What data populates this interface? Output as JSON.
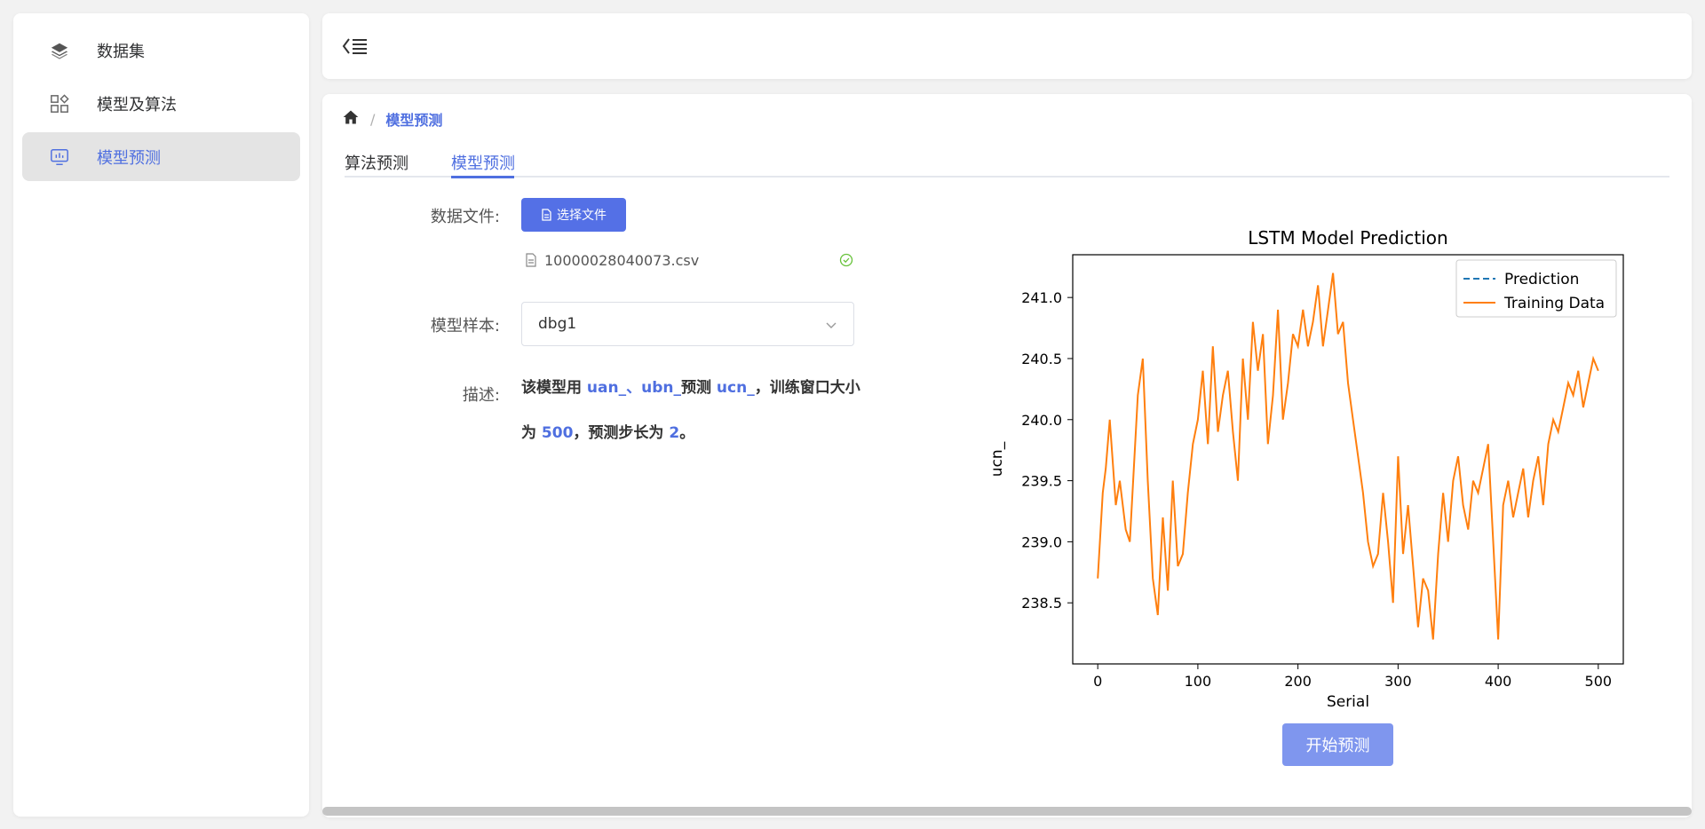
{
  "sidebar": {
    "items": [
      {
        "label": "数据集",
        "icon": "layers-icon",
        "active": false
      },
      {
        "label": "模型及算法",
        "icon": "grid-icon",
        "active": false
      },
      {
        "label": "模型预测",
        "icon": "monitor-icon",
        "active": true
      }
    ]
  },
  "header": {
    "collapse_icon": "menu-fold-icon"
  },
  "breadcrumb": {
    "home_icon": "home-icon",
    "separator": "/",
    "current": "模型预测"
  },
  "tabs": [
    {
      "label": "算法预测",
      "active": false
    },
    {
      "label": "模型预测",
      "active": true
    }
  ],
  "form": {
    "file_label": "数据文件:",
    "file_button": "选择文件",
    "file_name": "10000028040073.csv",
    "sample_label": "模型样本:",
    "sample_value": "dbg1",
    "desc_label": "描述:",
    "desc_parts": {
      "p1": "该模型用 ",
      "h1": "uan_、ubn_",
      "p2": "预测 ",
      "h2": "ucn_",
      "p3": "，训练窗口大小为 ",
      "h3": "500",
      "p4": "，预测步长为 ",
      "h4": "2",
      "p5": "。"
    }
  },
  "start_button": "开始预测",
  "colors": {
    "accent": "#5470e6",
    "prediction": "#1f77b4",
    "training": "#ff7f0e"
  },
  "chart_data": {
    "type": "line",
    "title": "LSTM Model Prediction",
    "xlabel": "Serial",
    "ylabel": "ucn_",
    "xlim": [
      -25,
      525
    ],
    "ylim": [
      238.0,
      241.35
    ],
    "xticks": [
      0,
      100,
      200,
      300,
      400,
      500
    ],
    "yticks": [
      238.5,
      239.0,
      239.5,
      240.0,
      240.5,
      241.0
    ],
    "legend_position": "top-right",
    "series": [
      {
        "name": "Prediction",
        "style": "dashed",
        "color": "#1f77b4",
        "x": [],
        "values": []
      },
      {
        "name": "Training Data",
        "style": "solid",
        "color": "#ff7f0e",
        "x": [
          0,
          5,
          8,
          12,
          18,
          22,
          28,
          32,
          36,
          40,
          45,
          50,
          55,
          60,
          65,
          70,
          75,
          80,
          85,
          90,
          95,
          100,
          105,
          110,
          115,
          120,
          125,
          130,
          135,
          140,
          145,
          150,
          155,
          160,
          165,
          170,
          175,
          180,
          185,
          190,
          195,
          200,
          205,
          210,
          215,
          220,
          225,
          230,
          235,
          240,
          245,
          250,
          255,
          260,
          265,
          270,
          275,
          280,
          285,
          290,
          295,
          300,
          305,
          310,
          315,
          320,
          325,
          330,
          335,
          340,
          345,
          350,
          355,
          360,
          365,
          370,
          375,
          380,
          385,
          390,
          395,
          400,
          405,
          410,
          415,
          420,
          425,
          430,
          435,
          440,
          445,
          450,
          455,
          460,
          465,
          470,
          475,
          480,
          485,
          490,
          495,
          500
        ],
        "values": [
          238.7,
          239.4,
          239.6,
          240.0,
          239.3,
          239.5,
          239.1,
          239.0,
          239.6,
          240.2,
          240.5,
          239.5,
          238.7,
          238.4,
          239.2,
          238.6,
          239.5,
          238.8,
          238.9,
          239.4,
          239.8,
          240.0,
          240.4,
          239.8,
          240.6,
          239.9,
          240.2,
          240.4,
          239.9,
          239.5,
          240.5,
          240.0,
          240.8,
          240.4,
          240.7,
          239.8,
          240.2,
          240.9,
          240.0,
          240.3,
          240.7,
          240.6,
          240.9,
          240.6,
          240.8,
          241.1,
          240.6,
          240.9,
          241.2,
          240.7,
          240.8,
          240.3,
          240.0,
          239.7,
          239.4,
          239.0,
          238.8,
          238.9,
          239.4,
          239.0,
          238.5,
          239.7,
          238.9,
          239.3,
          238.8,
          238.3,
          238.7,
          238.6,
          238.2,
          238.9,
          239.4,
          239.0,
          239.5,
          239.7,
          239.3,
          239.1,
          239.5,
          239.4,
          239.6,
          239.8,
          239.0,
          238.2,
          239.3,
          239.5,
          239.2,
          239.4,
          239.6,
          239.2,
          239.5,
          239.7,
          239.3,
          239.8,
          240.0,
          239.9,
          240.1,
          240.3,
          240.2,
          240.4,
          240.1,
          240.3,
          240.5,
          240.4
        ]
      }
    ]
  }
}
